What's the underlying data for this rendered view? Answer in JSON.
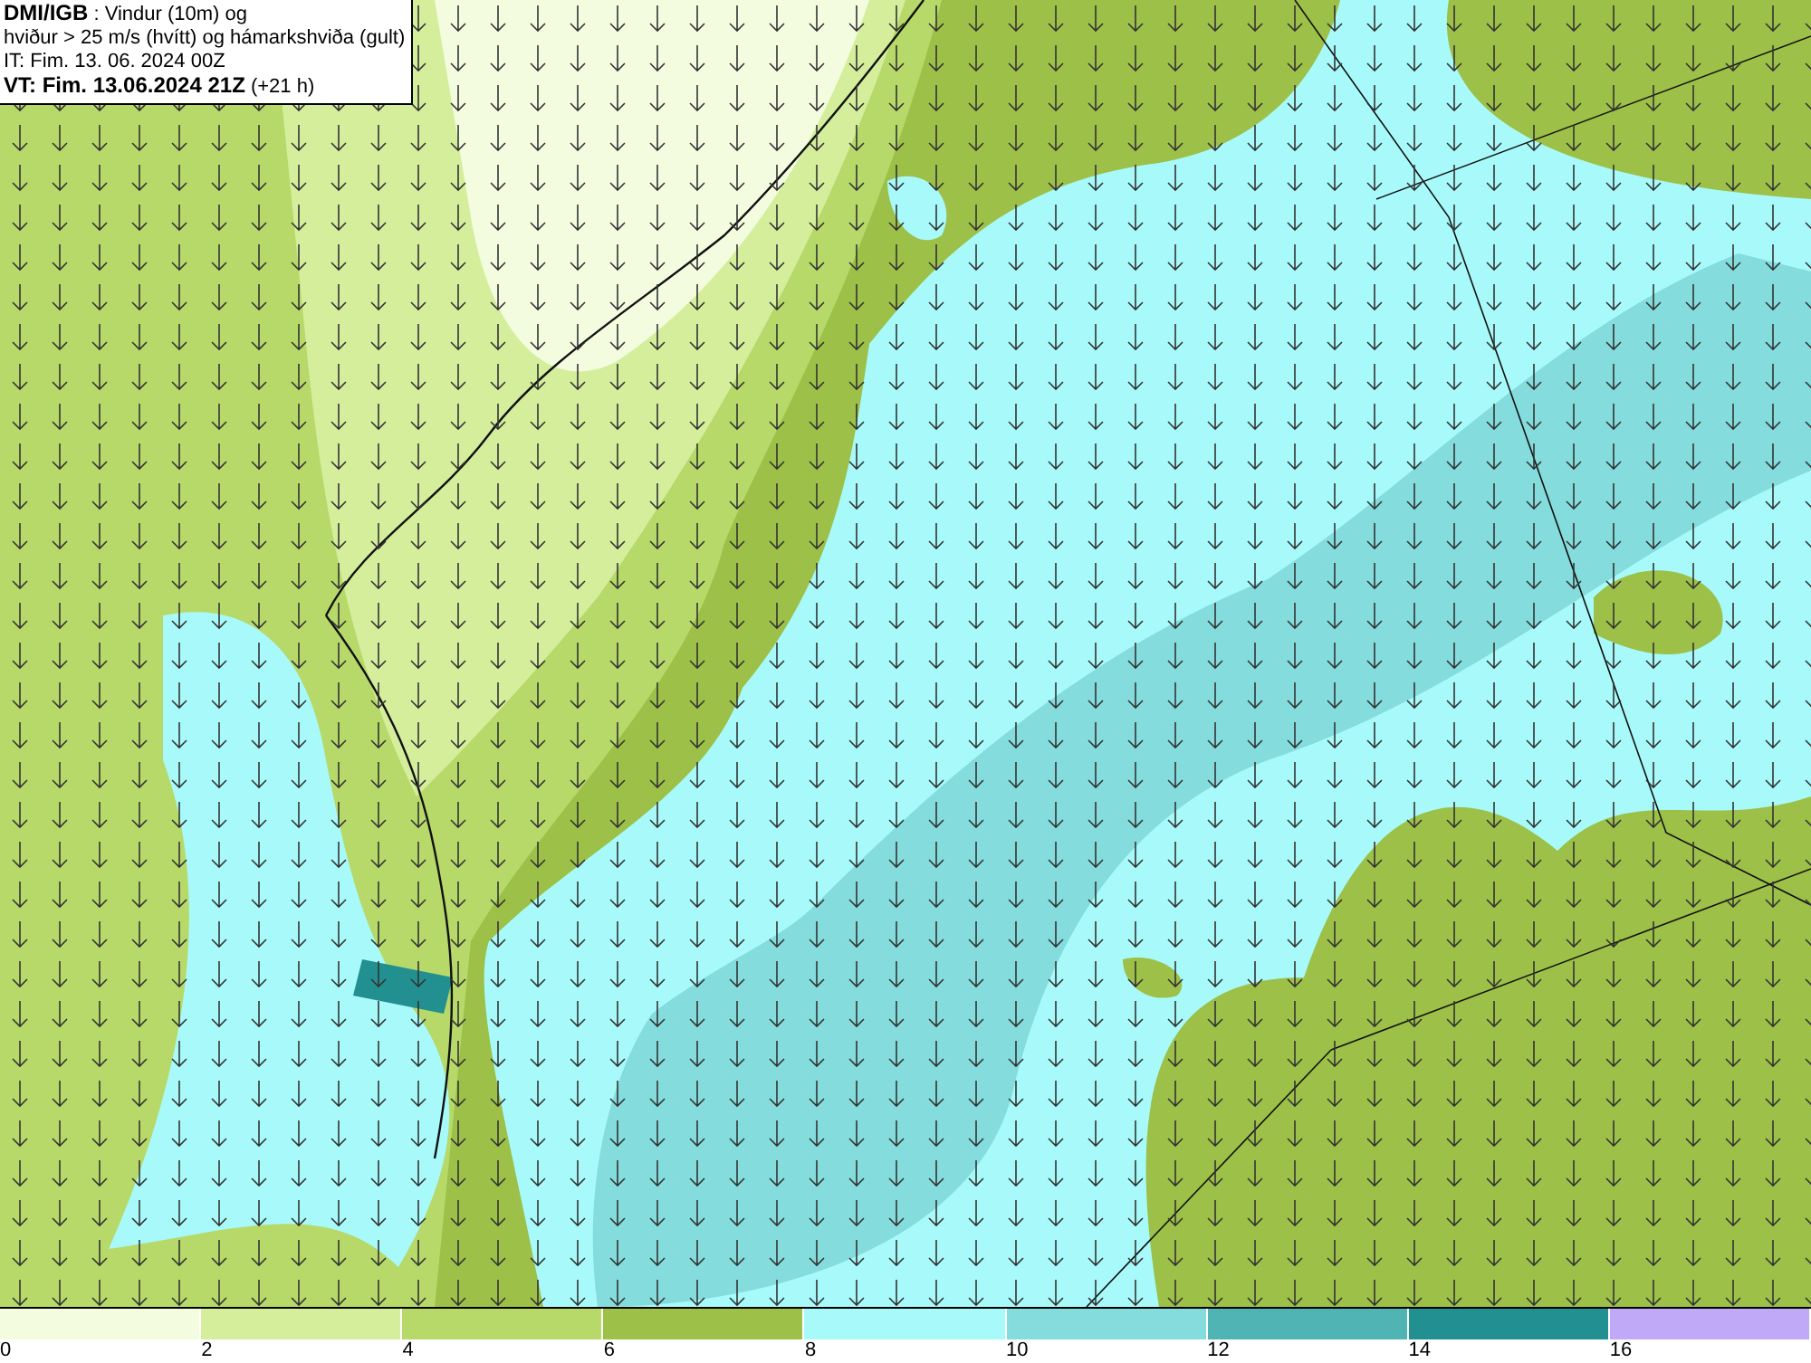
{
  "header": {
    "lines": [
      "**DMI/IGB** : Vindur (10m) og",
      "hviður > 25 m/s (hvítt) og hámarkshviða (gult)",
      "IT: Fim. 13. 06. 2024 00Z",
      "**VT: Fim. 13.06.2024 21Z** (+21 h)"
    ]
  },
  "legend": {
    "segments": [
      {
        "color": "#f4fce0"
      },
      {
        "color": "#d4ee9c"
      },
      {
        "color": "#b6d96a"
      },
      {
        "color": "#9cc048"
      },
      {
        "color": "#a8fafa"
      },
      {
        "color": "#84dcdc"
      },
      {
        "color": "#50b4b4"
      },
      {
        "color": "#229090"
      },
      {
        "color": "#c0aaf8"
      }
    ],
    "ticks": [
      "0",
      "2",
      "4",
      "6",
      "8",
      "10",
      "12",
      "14",
      "16"
    ]
  }
}
